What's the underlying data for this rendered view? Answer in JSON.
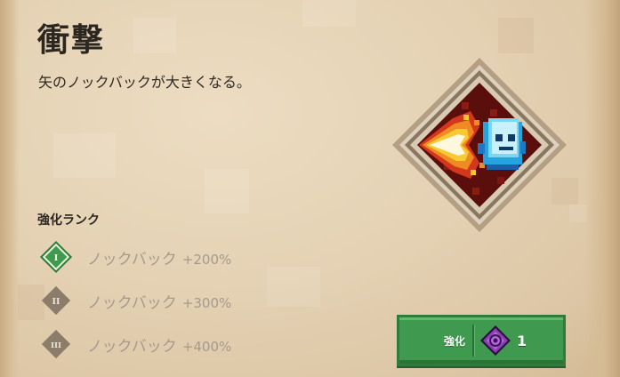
{
  "enchantment": {
    "title": "衝撃",
    "description": "矢のノックバックが大きくなる。",
    "icon": "punch-enchantment-icon"
  },
  "ranks": {
    "label": "強化ランク",
    "levels": [
      {
        "numeral": "I",
        "name": "ノックバック",
        "value": "+200%",
        "active": true
      },
      {
        "numeral": "II",
        "name": "ノックバック",
        "value": "+300%",
        "active": false
      },
      {
        "numeral": "III",
        "name": "ノックバック",
        "value": "+400%",
        "active": false
      }
    ]
  },
  "enchant_button": {
    "label": "強化",
    "cost_icon": "enchantment-point-icon",
    "cost": "1"
  },
  "colors": {
    "button_green": "#3f9a4f",
    "active_rank_green": "#3e9a4c",
    "inactive_rank_gray": "#8c7d6b",
    "enchant_point_purple": "#8a3fb3"
  }
}
